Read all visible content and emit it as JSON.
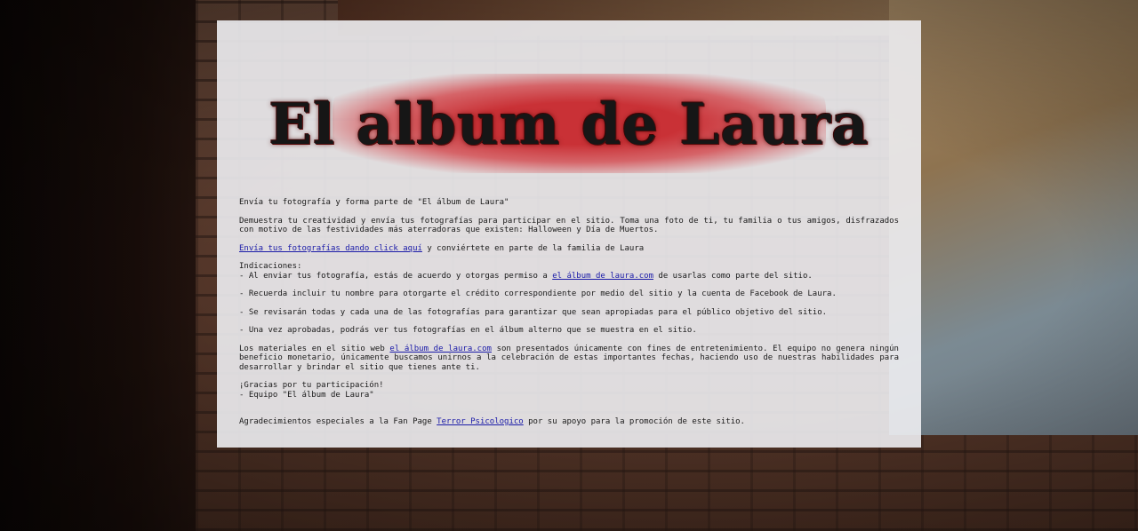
{
  "logo": {
    "text": "El album de Laura"
  },
  "intro": {
    "heading": "Envía tu fotografía y forma parte de \"El álbum de Laura\"",
    "description": "Demuestra tu creatividad y envía tus fotografías para participar en el sitio. Toma una foto de ti, tu familia o tus amigos, disfrazados con motivo de las festividades más aterradoras que existen: Halloween y Día de Muertos."
  },
  "cta": {
    "link_text": "Envía tus fotografías dando click aquí",
    "rest_text": " y conviértete en parte de la familia de Laura"
  },
  "indications": {
    "title": "Indicaciones:",
    "item1_pre": "- Al enviar tus fotografía, estás de acuerdo y otorgas permiso a ",
    "item1_link": "el álbum de laura.com",
    "item1_post": " de usarlas como parte del sitio.",
    "item2": "- Recuerda incluir tu nombre para otorgarte el crédito correspondiente por medio del sitio y la cuenta de Facebook de Laura.",
    "item3": "- Se revisarán todas y cada una de las fotografías para garantizar que sean apropiadas para el público objetivo del sitio.",
    "item4": "- Una vez aprobadas, podrás ver tus fotografías en el álbum alterno que se muestra en el sitio."
  },
  "disclaimer": {
    "pre": "Los materiales en el sitio web ",
    "link": "el álbum de laura.com",
    "post": " son presentados únicamente con fines de entretenimiento. El equipo no genera ningún beneficio monetario, únicamente buscamos unirnos a la celebración de estas importantes fechas, haciendo uso de nuestras habilidades para desarrollar y brindar el sitio que tienes ante ti."
  },
  "thanks": {
    "line1": "¡Gracias por tu participación!",
    "line2": "- Equipo \"El álbum de Laura\""
  },
  "acknowledgement": {
    "pre": "Agradecimientos especiales a la Fan Page ",
    "link": "Terror Psicologico",
    "post": " por su apoyo para la promoción de este sitio."
  },
  "colors": {
    "link": "#1a1aa8",
    "logo_glow": "#c8282d",
    "panel": "#eeeef2"
  }
}
